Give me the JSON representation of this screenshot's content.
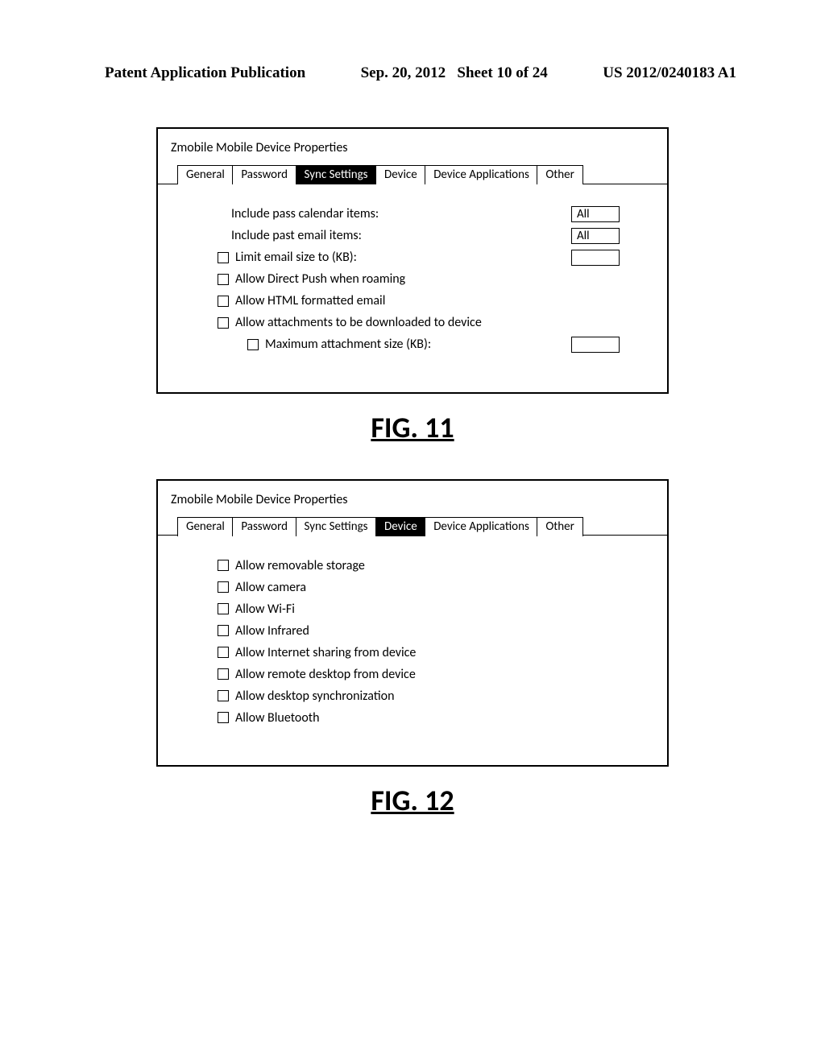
{
  "header": {
    "publication_label": "Patent Application Publication",
    "date": "Sep. 20, 2012",
    "sheet": "Sheet 10 of 24",
    "pub_number": "US 2012/0240183 A1"
  },
  "figures": [
    {
      "figure_label": "FIG. 11",
      "window_title": "Zmobile Mobile Device Properties",
      "active_tab_index": 2,
      "tabs": [
        "General",
        "Password",
        "Sync Settings",
        "Device",
        "Device Applications",
        "Other"
      ],
      "rows": [
        {
          "checkbox": false,
          "indent": "indent0",
          "label": "Include pass calendar items:",
          "value": "All"
        },
        {
          "checkbox": false,
          "indent": "indent0",
          "label": "Include past email items:",
          "value": "All"
        },
        {
          "checkbox": true,
          "indent": "indent1",
          "label": "Limit email size to (KB):",
          "value": ""
        },
        {
          "checkbox": true,
          "indent": "indent1",
          "label": "Allow Direct Push when roaming",
          "value": null
        },
        {
          "checkbox": true,
          "indent": "indent1",
          "label": "Allow HTML formatted email",
          "value": null
        },
        {
          "checkbox": true,
          "indent": "indent1",
          "label": "Allow attachments to be downloaded to device",
          "value": null
        },
        {
          "checkbox": true,
          "indent": "indent2",
          "label": "Maximum attachment size (KB):",
          "value": ""
        }
      ]
    },
    {
      "figure_label": "FIG. 12",
      "window_title": "Zmobile Mobile Device Properties",
      "active_tab_index": 3,
      "tabs": [
        "General",
        "Password",
        "Sync Settings",
        "Device",
        "Device Applications",
        "Other"
      ],
      "rows": [
        {
          "checkbox": true,
          "indent": "indent1",
          "label": "Allow removable storage",
          "value": null
        },
        {
          "checkbox": true,
          "indent": "indent1",
          "label": "Allow camera",
          "value": null
        },
        {
          "checkbox": true,
          "indent": "indent1",
          "label": "Allow Wi-Fi",
          "value": null
        },
        {
          "checkbox": true,
          "indent": "indent1",
          "label": "Allow Infrared",
          "value": null
        },
        {
          "checkbox": true,
          "indent": "indent1",
          "label": "Allow Internet sharing from device",
          "value": null
        },
        {
          "checkbox": true,
          "indent": "indent1",
          "label": "Allow remote desktop from device",
          "value": null
        },
        {
          "checkbox": true,
          "indent": "indent1",
          "label": "Allow desktop synchronization",
          "value": null
        },
        {
          "checkbox": true,
          "indent": "indent1",
          "label": "Allow Bluetooth",
          "value": null
        }
      ]
    }
  ]
}
